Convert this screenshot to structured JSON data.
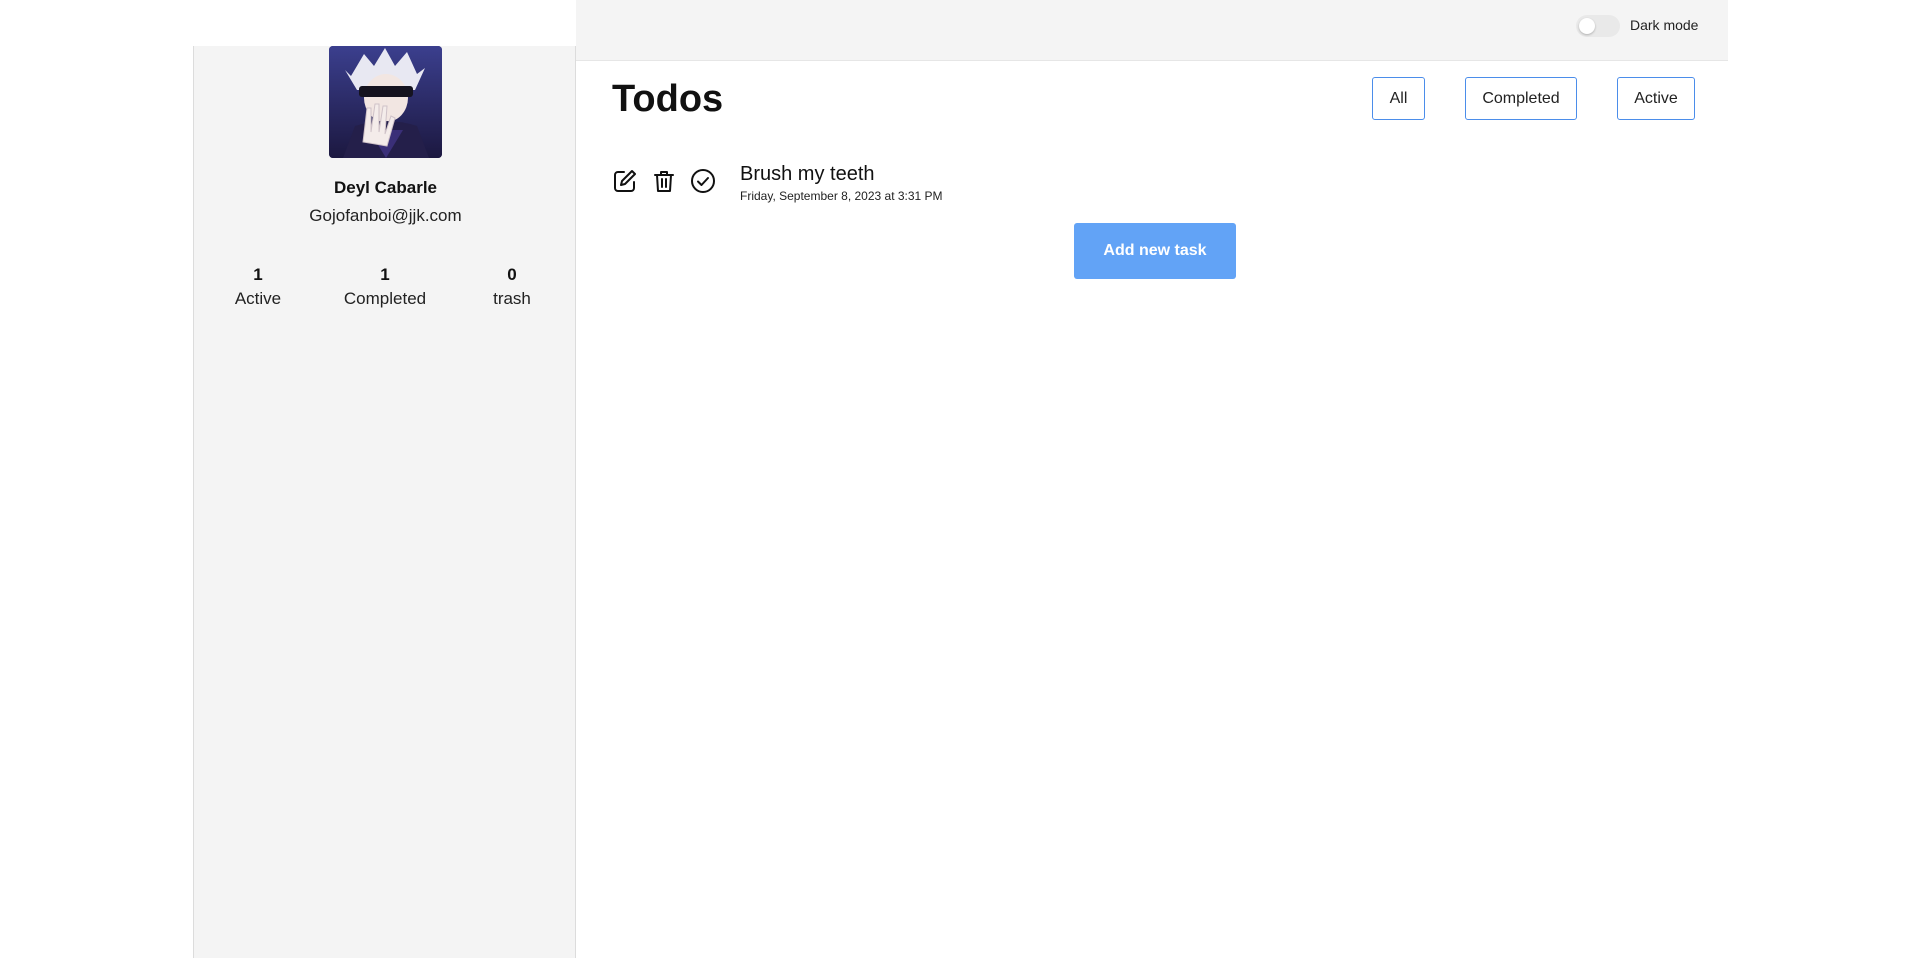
{
  "sidebar": {
    "profile": {
      "name": "Deyl Cabarle",
      "email": "Gojofanboi@jjk.com"
    },
    "stats": [
      {
        "count": "1",
        "label": "Active"
      },
      {
        "count": "1",
        "label": "Completed"
      },
      {
        "count": "0",
        "label": "trash"
      }
    ]
  },
  "header": {
    "dark_mode_label": "Dark mode",
    "dark_mode_enabled": false
  },
  "main": {
    "title": "Todos",
    "filters": [
      "All",
      "Completed",
      "Active"
    ],
    "todos": [
      {
        "title": "Brush my teeth",
        "date": "Friday, September 8, 2023 at 3:31 PM",
        "actions": [
          "edit-icon",
          "trash-icon",
          "check-circle-icon"
        ]
      }
    ],
    "add_button_label": "Add new task"
  },
  "colors": {
    "accent": "#4b8dea",
    "add_button": "#62a3f6",
    "panel_bg": "#f4f4f4"
  }
}
